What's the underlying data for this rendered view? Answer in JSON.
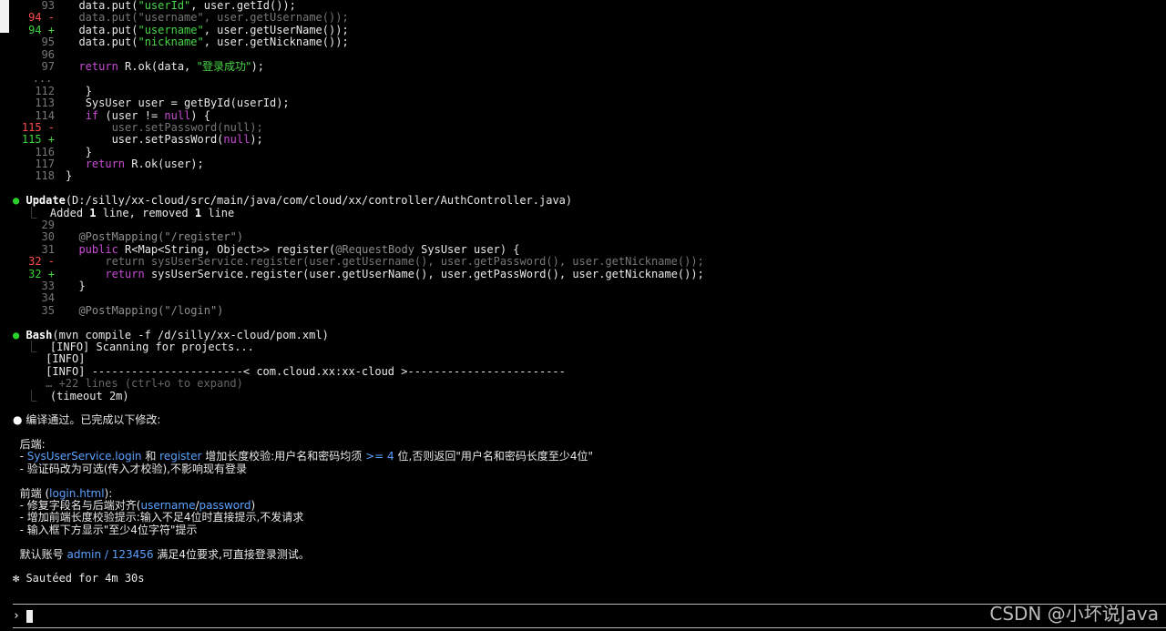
{
  "diff1": {
    "l93": {
      "num": "93",
      "pre": "data.put(",
      "key": "\"userId\"",
      "post": ", user.getId());"
    },
    "l94d": {
      "num": "94 -",
      "text": "data.put(\"username\", user.getUsername());"
    },
    "l94a": {
      "num": "94 +",
      "pre": "data.put(",
      "key": "\"username\"",
      "post": ", user.getUserName());"
    },
    "l95": {
      "num": "95",
      "pre": "data.put(",
      "key": "\"nickname\"",
      "post": ", user.getNickname());"
    },
    "l96": {
      "num": "96"
    },
    "l97": {
      "num": "97",
      "kw": "return",
      "pre": " R.ok(data, ",
      "str": "\"登录成功\"",
      "post": ");"
    },
    "ellipsis": "...",
    "l112": {
      "num": "112",
      "text": "}"
    },
    "l113": {
      "num": "113",
      "text": "SysUser user = getById(userId);"
    },
    "l114": {
      "num": "114",
      "kw": "if",
      "pre": " (user != ",
      "kw2": "null",
      "post": ") {"
    },
    "l115d": {
      "num": "115 -",
      "text": "user.setPassword(null);"
    },
    "l115a": {
      "num": "115 +",
      "pre": "user.setPassWord(",
      "kw": "null",
      "post": ");"
    },
    "l116": {
      "num": "116",
      "text": "}"
    },
    "l117": {
      "num": "117",
      "kw": "return",
      "post": " R.ok(user);"
    },
    "l118": {
      "num": "118",
      "text": "}"
    }
  },
  "update": {
    "bullet": "●",
    "tool": "Update",
    "path": "(D:/silly/xx-cloud/src/main/java/com/cloud/xx/controller/AuthController.java)",
    "summary_pre": "Added ",
    "added": "1",
    "summary_mid": " line, removed ",
    "removed": "1",
    "summary_post": " line",
    "l29": {
      "num": "29"
    },
    "l30": {
      "num": "30",
      "text": "@PostMapping(\"/register\")"
    },
    "l31": {
      "num": "31",
      "kw": "public",
      "pre": " R<Map<String, Object>> register(",
      "ann": "@RequestBody",
      "post": " SysUser user) {"
    },
    "l32d": {
      "num": "32 -",
      "text": "return sysUserService.register(user.getUsername(), user.getPassword(), user.getNickname());"
    },
    "l32a": {
      "num": "32 +",
      "kw": "return",
      "post": " sysUserService.register(user.getUserName(), user.getPassWord(), user.getNickname());"
    },
    "l33": {
      "num": "33",
      "text": "}"
    },
    "l34": {
      "num": "34"
    },
    "l35": {
      "num": "35",
      "text": "@PostMapping(\"/login\")"
    }
  },
  "bash": {
    "bullet": "●",
    "tool": "Bash",
    "cmd": "(mvn compile -f /d/silly/xx-cloud/pom.xml)",
    "lines": [
      "[INFO] Scanning for projects...",
      "[INFO]",
      "[INFO] -----------------------< com.cloud.xx:xx-cloud >------------------------"
    ],
    "more": "… +22 lines (ctrl+o to expand)",
    "timeout": "(timeout 2m)"
  },
  "result": {
    "bullet": "●",
    "intro": "编译通过。已完成以下修改:",
    "backend_heading": "后端:",
    "backend_1_pre": "- ",
    "backend_1_a": "SysUserService.login",
    "backend_1_b": " 和 ",
    "backend_1_c": "register",
    "backend_1_d": " 增加长度校验:用户名和密码均须 ",
    "backend_1_e": ">= 4",
    "backend_1_f": " 位,否则返回\"用户名和密码长度至少4位\"",
    "backend_2": "- 验证码改为可选(传入才校验),不影响现有登录",
    "frontend_heading_a": "前端 (",
    "frontend_heading_file": "login.html",
    "frontend_heading_b": "):",
    "frontend_1_pre": "- 修复字段名与后端对齐(",
    "frontend_1_u": "username",
    "frontend_1_slash": "/",
    "frontend_1_p": "password",
    "frontend_1_post": ")",
    "frontend_2": "- 增加前端长度校验提示:输入不足4位时直接提示,不发请求",
    "frontend_3": "- 输入框下方显示\"至少4位字符\"提示",
    "account_pre": "默认账号 ",
    "account_val": "admin / 123456",
    "account_post": " 满足4位要求,可直接登录测试。"
  },
  "status": {
    "icon": "✻",
    "text": " Sautéed for 4m 30s"
  },
  "prompt": {
    "symbol": "›"
  },
  "watermark": "CSDN @小坏说Java"
}
